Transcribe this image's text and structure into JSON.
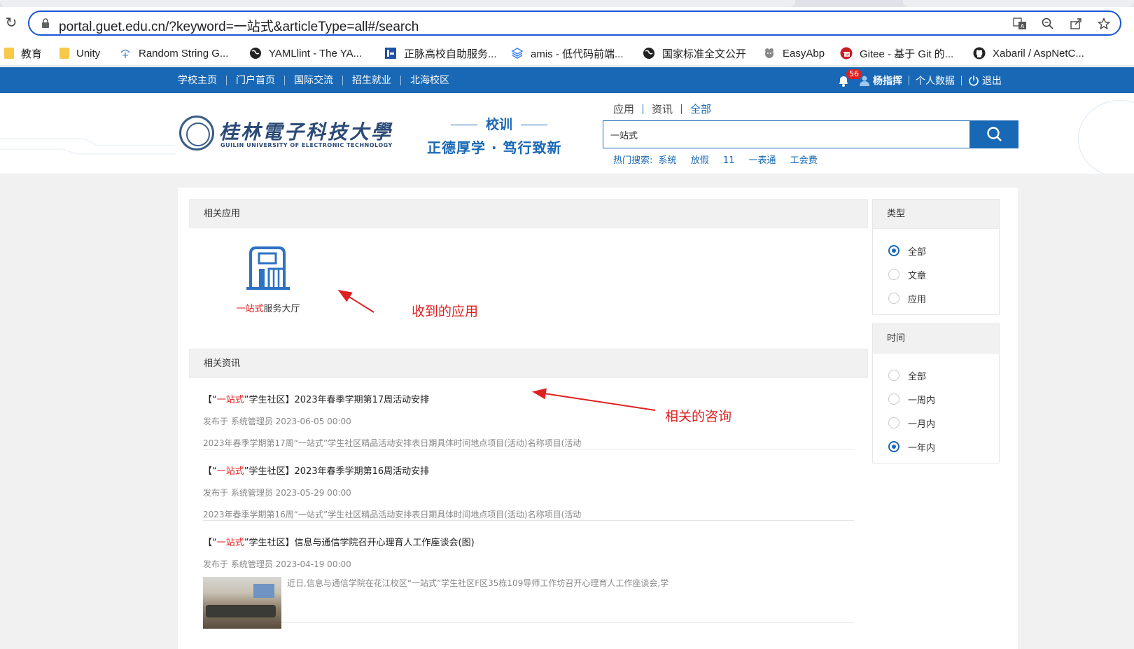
{
  "browser": {
    "url": "portal.guet.edu.cn/?keyword=一站式&articleType=all#/search",
    "bookmarks": [
      {
        "label": "教育",
        "icon": "folder-icon"
      },
      {
        "label": "Unity",
        "icon": "folder-icon"
      },
      {
        "label": "Random String G...",
        "icon": "random-string-icon"
      },
      {
        "label": "YAMLlint - The YA...",
        "icon": "globe-icon"
      },
      {
        "label": "正脉高校自助服务...",
        "icon": "zhengmai-icon"
      },
      {
        "label": "amis - 低代码前端...",
        "icon": "amis-icon"
      },
      {
        "label": "国家标准全文公开",
        "icon": "globe-icon"
      },
      {
        "label": "EasyAbp",
        "icon": "easyabp-icon"
      },
      {
        "label": "Gitee - 基于 Git 的...",
        "icon": "gitee-icon"
      },
      {
        "label": "Xabaril / AspNetC...",
        "icon": "github-icon"
      }
    ]
  },
  "topnav": {
    "links": [
      "学校主页",
      "门户首页",
      "国际交流",
      "招生就业",
      "北海校区"
    ],
    "notifications": "56",
    "username": "杨指挥",
    "personal": "个人数据",
    "logout": "退出"
  },
  "header": {
    "logo_cn": "桂林電子科技大學",
    "logo_en": "GUILIN UNIVERSITY OF ELECTRONIC TECHNOLOGY",
    "motto_head": "校训",
    "motto": "正德厚学 · 笃行致新",
    "scope": [
      "应用",
      "资讯",
      "全部"
    ],
    "search_value": "一站式",
    "hot_label": "热门搜索:",
    "hot": [
      "系统",
      "放假",
      "11",
      "一表通",
      "工会费"
    ]
  },
  "apps_section": {
    "title": "相关应用",
    "app_highlight": "一站式",
    "app_rest": "服务大厅",
    "annotation": "收到的应用"
  },
  "news_section": {
    "title": "相关资讯",
    "annotation": "相关的咨询",
    "items": [
      {
        "prefix": "【“",
        "highlight": "一站式",
        "title_rest": "”学生社区】2023年春季学期第17周活动安排",
        "meta": "发布于 系统管理员 2023-06-05 00:00",
        "summary": "2023年春季学期第17周“一站式”学生社区精品活动安排表日期具体时间地点项目(活动)名称项目(活动"
      },
      {
        "prefix": "【“",
        "highlight": "一站式",
        "title_rest": "”学生社区】2023年春季学期第16周活动安排",
        "meta": "发布于 系统管理员 2023-05-29 00:00",
        "summary": "2023年春季学期第16周“一站式”学生社区精品活动安排表日期具体时间地点项目(活动)名称项目(活动"
      },
      {
        "prefix": "【“",
        "highlight": "一站式",
        "title_rest": "”学生社区】信息与通信学院召开心理育人工作座谈会(图)",
        "meta": "发布于 系统管理员 2023-04-19 00:00",
        "summary": "近日,信息与通信学院在花江校区“一站式”学生社区F区35栋109导师工作坊召开心理育人工作座谈会,学"
      }
    ]
  },
  "filters": {
    "type": {
      "title": "类型",
      "options": [
        "全部",
        "文章",
        "应用"
      ],
      "selected": "全部"
    },
    "time": {
      "title": "时间",
      "options": [
        "全部",
        "一周内",
        "一月内",
        "一年内"
      ],
      "selected": "一年内"
    }
  },
  "colors": {
    "brand_blue": "#1868b5",
    "highlight_red": "#e02020",
    "annotation_red": "#e02020"
  }
}
